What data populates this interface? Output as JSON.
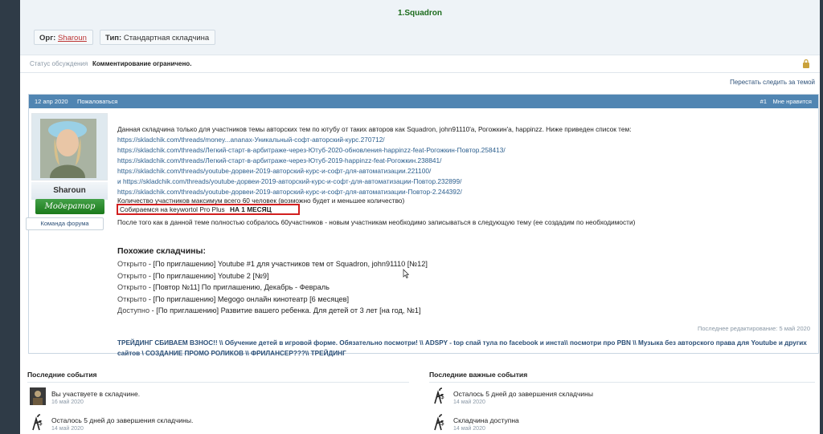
{
  "header": {
    "tagline": "1.Squadron",
    "org_label": "Орг:",
    "org_value": "Sharoun",
    "type_label": "Тип:",
    "type_value": "Стандартная складчина"
  },
  "status": {
    "label": "Статус обсуждения",
    "value": "Комментирование ограничено."
  },
  "unfollow_link": "Перестать следить за темой",
  "post": {
    "date": "12 апр 2020",
    "report": "Пожаловаться",
    "number": "#1",
    "like": "Мне нравится",
    "author": {
      "name": "Sharoun",
      "role": "Модератор",
      "team": "Команда форума"
    },
    "intro": "Данная складчина только для участников темы авторских тем по ютубу от таких авторов как Squadron, john91110'a, Рогожкин'а, happinzz. Ниже приведен список тем:",
    "links": [
      "https://skladchik.com/threads/money...ananax-Уникальный-софт-авторский-курс.270712/",
      "https://skladchik.com/threads/Легкий-старт-в-арбитраже-через-Ютуб-2020-обновления-happinzz-feat-Рогожкин-Повтор.258413/",
      "https://skladchik.com/threads/Легкий-старт-в-арбитраже-через-Ютуб-2019-happinzz-feat-Рогожкин.238841/",
      "https://skladchik.com/threads/youtube-дорвеи-2019-авторский-курс-и-софт-для-автоматизации.221100/",
      "и https://skladchik.com/threads/youtube-дорвеи-2019-авторский-курс-и-софт-для-автоматизации-Повтор.232899/",
      "https://skladchik.com/threads/youtube-дорвеи-2019-авторский-курс-и-софт-для-автоматизации-Повтор-2.244392/"
    ],
    "max_participants": "Количество участников максимум всего 60 человек (возможно будет и меньшее количество)",
    "highlight_prefix": "Собираемся на keywortol Pro Plus",
    "highlight_bold": "НА 1 МЕСЯЦ",
    "after_note": "После того как в данной теме полностью собралось 60участников - новым участникам необходимо записываться в следующую тему (ее создадим по необходимости)",
    "similar_title": "Похожие складчины:",
    "similar": [
      {
        "status": "Открыто",
        "text": "[По приглашению] Youtube #1 для участников тем от Squadron, john91110 [№12]"
      },
      {
        "status": "Открыто",
        "text": "[По приглашению] Youtube 2 [№9]"
      },
      {
        "status": "Открыто",
        "text": "[Повтор №11] По приглашению, Декабрь - Февраль"
      },
      {
        "status": "Открыто",
        "text": "[По приглашению] Megogo онлайн кинотеатр [6 месяцев]"
      },
      {
        "status": "Доступно",
        "text": "[По приглашению] Развитие вашего ребенка. Для детей от 3 лет [на год, №1]"
      }
    ],
    "edited_label": "Последнее редактирование:",
    "edited_date": "5 май 2020",
    "signature": "ТРЕЙДИНГ СБИВАЕМ ВЗНОС!! \\\\ Обучение детей в игровой форме. Обязательно посмотри! \\\\ ADSPY - top спай тула по facebook и инста\\\\ посмотри про PBN \\\\ Музыка без авторского права для Youtube и других сайтов \\ СОЗДАНИЕ ПРОМО РОЛИКОВ \\\\ ФРИЛАНСЕР???\\\\ ТРЕЙДИНГ"
  },
  "recent_events": {
    "title": "Последние события",
    "items": [
      {
        "text": "Вы участвуете в складчине.",
        "date": "16 май 2020"
      },
      {
        "text": "Осталось 5 дней до завершения складчины.",
        "date": "14 май 2020"
      }
    ]
  },
  "important_events": {
    "title": "Последние важные события",
    "items": [
      {
        "text": "Осталось 5 дней до завершения складчины",
        "date": "14 май 2020"
      },
      {
        "text": "Складчина доступна",
        "date": "14 май 2020"
      }
    ]
  },
  "colors": {
    "post_bar": "#5085b2",
    "highlight_border": "#d21f1f",
    "role_badge": "#1b7a1b",
    "link": "#2c5f8e"
  }
}
